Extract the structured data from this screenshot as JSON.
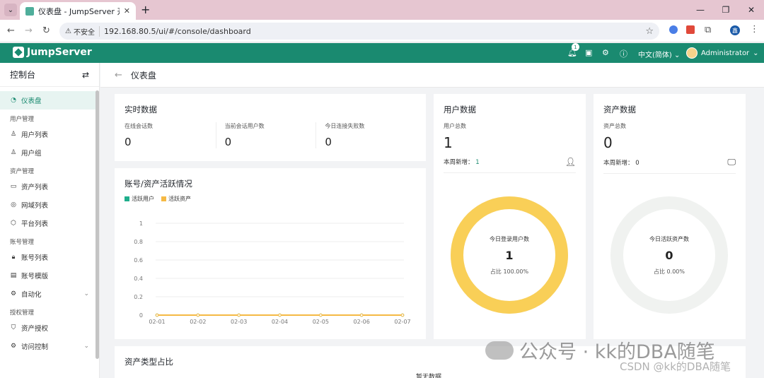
{
  "browser": {
    "tab_title": "仪表盘 - JumpServer 开源堡垒...",
    "security_label": "不安全",
    "url": "192.168.80.5/ui/#/console/dashboard",
    "profile_initial": "鑫"
  },
  "header": {
    "logo_text": "JumpServer",
    "notification_count": "1",
    "language": "中文(简体)",
    "user": "Administrator",
    "brand_color": "#1a8a70"
  },
  "sidebar": {
    "title": "控制台",
    "items": [
      {
        "type": "item",
        "label": "仪表盘",
        "icon": "dashboard-icon",
        "active": true
      },
      {
        "type": "group",
        "label": "用户管理"
      },
      {
        "type": "item",
        "label": "用户列表",
        "icon": "user-icon"
      },
      {
        "type": "item",
        "label": "用户组",
        "icon": "user-group-icon"
      },
      {
        "type": "group",
        "label": "资产管理"
      },
      {
        "type": "item",
        "label": "资产列表",
        "icon": "monitor-icon"
      },
      {
        "type": "item",
        "label": "网域列表",
        "icon": "domain-icon"
      },
      {
        "type": "item",
        "label": "平台列表",
        "icon": "platform-icon"
      },
      {
        "type": "group",
        "label": "账号管理"
      },
      {
        "type": "item",
        "label": "账号列表",
        "icon": "lock-icon"
      },
      {
        "type": "item",
        "label": "账号模版",
        "icon": "template-icon"
      },
      {
        "type": "item",
        "label": "自动化",
        "icon": "automation-icon",
        "expandable": true
      },
      {
        "type": "group",
        "label": "授权管理"
      },
      {
        "type": "item",
        "label": "资产授权",
        "icon": "shield-icon"
      },
      {
        "type": "item",
        "label": "访问控制",
        "icon": "gear-icon",
        "expandable": true
      }
    ]
  },
  "page": {
    "title": "仪表盘"
  },
  "realtime": {
    "title": "实时数据",
    "stats": [
      {
        "label": "在线会话数",
        "value": "0"
      },
      {
        "label": "当前会话用户数",
        "value": "0"
      },
      {
        "label": "今日连接失败数",
        "value": "0"
      }
    ]
  },
  "activity": {
    "title": "账号/资产活跃情况",
    "legend": [
      {
        "label": "活跃用户",
        "color": "#1fae8c"
      },
      {
        "label": "活跃资产",
        "color": "#f5b944"
      }
    ]
  },
  "chart_data": {
    "type": "line",
    "categories": [
      "02-01",
      "02-02",
      "02-03",
      "02-04",
      "02-05",
      "02-06",
      "02-07"
    ],
    "yticks": [
      "0",
      "0.2",
      "0.4",
      "0.6",
      "0.8",
      "1"
    ],
    "ylim": [
      0,
      1
    ],
    "grid": true,
    "series": [
      {
        "name": "活跃用户",
        "values": [
          0,
          0,
          0,
          0,
          0,
          0,
          0
        ],
        "color": "#1fae8c"
      },
      {
        "name": "活跃资产",
        "values": [
          0,
          0,
          0,
          0,
          0,
          0,
          0
        ],
        "color": "#f5b944"
      }
    ]
  },
  "users": {
    "title": "用户数据",
    "total_label": "用户总数",
    "total": "1",
    "new_label": "本周新增：",
    "new_value": "1",
    "ring_label": "今日登录用户数",
    "ring_value": "1",
    "ring_pct": "占比 100.00%",
    "ring_fraction": 1,
    "ring_color": "#f9cf57"
  },
  "assets": {
    "title": "资产数据",
    "total_label": "资产总数",
    "total": "0",
    "new_label": "本周新增：",
    "new_value": "0",
    "ring_label": "今日活跃资产数",
    "ring_value": "0",
    "ring_pct": "占比 0.00%",
    "ring_fraction": 0,
    "ring_color": "#f2f4f2"
  },
  "asset_types": {
    "title": "资产类型占比",
    "empty": "暂无数据"
  },
  "watermark": {
    "line1": "公众号 · kk的DBA随笔",
    "line2": "CSDN @kk的DBA随笔"
  }
}
